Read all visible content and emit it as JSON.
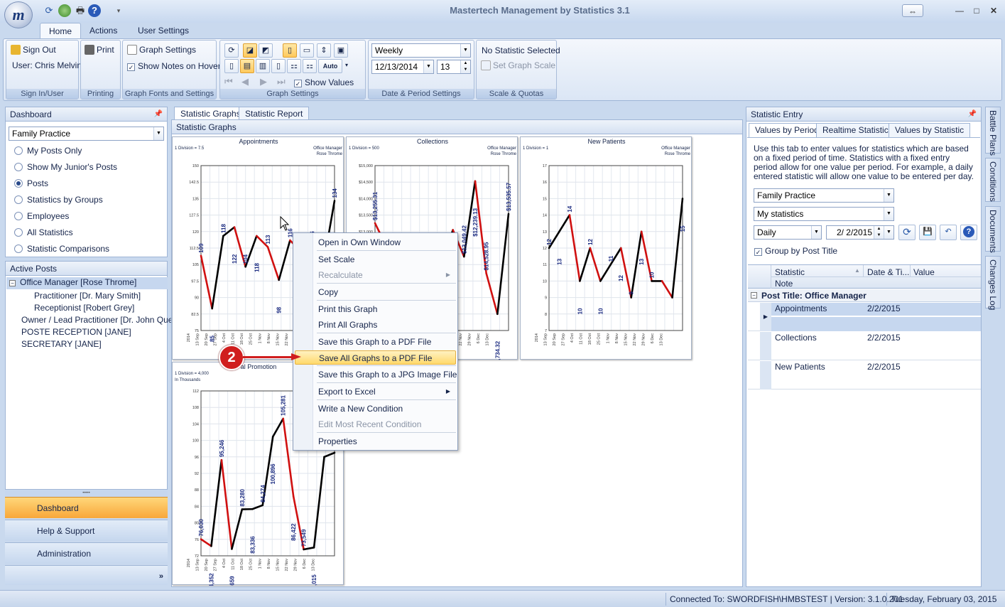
{
  "app": {
    "logo_letter": "m",
    "title": "Mastertech Management by Statistics 3.1"
  },
  "ribbon_tabs": [
    "Home",
    "Actions",
    "User Settings"
  ],
  "ribbon": {
    "sign_out": "Sign Out",
    "user": "User: Chris Melvin",
    "group_signin": "Sign In/User",
    "print": "Print",
    "group_printing": "Printing",
    "graph_settings": "Graph Settings",
    "show_notes": "Show Notes on Hover",
    "group_fonts": "Graph Fonts and Settings",
    "show_values": "Show Values",
    "group_graph": "Graph Settings",
    "auto": "Auto",
    "period": "Weekly",
    "date": "12/13/2014",
    "count": "13",
    "group_date": "Date & Period Settings",
    "no_stat": "No Statistic Selected",
    "set_scale": "Set Graph Scale",
    "group_scale": "Scale & Quotas"
  },
  "dashboard": {
    "title": "Dashboard",
    "combo": "Family Practice",
    "options": [
      "My Posts Only",
      "Show My Junior's Posts",
      "Posts",
      "Statistics by Groups",
      "Employees",
      "All Statistics",
      "Statistic Comparisons"
    ]
  },
  "active_posts": {
    "title": "Active Posts",
    "items": [
      "Office Manager [Rose Throme]",
      "Practitioner  [Dr. Mary Smith]",
      "Receptionist  [Robert Grey]",
      "Owner / Lead Practitioner  [Dr. John Que]",
      "POSTE RECEPTION [JANE]",
      "SECRETARY [JANE]"
    ]
  },
  "nav": [
    "Dashboard",
    "Help & Support",
    "Administration"
  ],
  "content_tabs": [
    "Statistic Graphs",
    "Statistic Report"
  ],
  "content_title": "Statistic Graphs",
  "charts": [
    {
      "title": "Appointments",
      "division": "1 Division = 7.5",
      "sub": "",
      "owner": "Office Manager",
      "owner2": "Rose Throme",
      "ylim": [
        75,
        150
      ],
      "yticks": [
        "150",
        "142.5",
        "135",
        "127.5",
        "120",
        "112.5",
        "105",
        "97.5",
        "90",
        "82.5",
        "75"
      ],
      "values": [
        109,
        85,
        118,
        122,
        104,
        118,
        113,
        98,
        116,
        111,
        116,
        105,
        134
      ],
      "labels": [
        "109",
        "85",
        "118",
        "122",
        "104",
        "118",
        "113",
        "98",
        "116",
        "",
        "16",
        "",
        "134"
      ]
    },
    {
      "title": "Collections",
      "division": "1 Division = 500",
      "sub": "",
      "owner": "Office Manager",
      "owner2": "Rose Throme",
      "ylim": [
        10000,
        15000
      ],
      "yticks": [
        "$15,000",
        "$14,500",
        "$14,000",
        "$13,500",
        "$13,000",
        "$12,500",
        "$12,000",
        "$11,500",
        "$11,000",
        "$10,500",
        "$10,000"
      ],
      "values": [
        13255.31,
        12561.05,
        12600,
        12912.14,
        11782,
        12261,
        12004,
        13049.42,
        12239.13,
        14528.95,
        11734.32,
        10500,
        13535.57
      ],
      "labels": [
        "$13,255.31",
        "$12,561.05",
        "3",
        "$12,912.14",
        "$11,782",
        "",
        "$12,61",
        "04",
        "$13,049.42",
        "$12,239.13",
        "$14,528.95",
        "$11,734.32",
        "$13,535.57"
      ]
    },
    {
      "title": "New Patients",
      "division": "1 Division = 1",
      "sub": "",
      "owner": "Office Manager",
      "owner2": "Rose Throme",
      "ylim": [
        7,
        17
      ],
      "yticks": [
        "17",
        "16",
        "15",
        "14",
        "13",
        "12",
        "11",
        "10",
        "9",
        "8",
        "7"
      ],
      "values": [
        12,
        13,
        14,
        10,
        12,
        10,
        11,
        12,
        9,
        13,
        10,
        10,
        9,
        15
      ],
      "labels": [
        "12",
        "13",
        "14",
        "10",
        "12",
        "10",
        "11",
        "12",
        "9",
        "13",
        "10",
        "",
        "",
        "15"
      ]
    },
    {
      "title": "al Promotion",
      "division": "1 Division = 4,000",
      "sub": "In Thousands",
      "owner": "",
      "owner2": "",
      "ylim": [
        72,
        112
      ],
      "yticks": [
        "112",
        "108",
        "104",
        "100",
        "96",
        "92",
        "88",
        "84",
        "80",
        "76",
        "72"
      ],
      "values": [
        76.03,
        74.352,
        95.246,
        73.659,
        83.28,
        83.336,
        84.274,
        100.896,
        105.281,
        86.422,
        73.549,
        74.015,
        96,
        97
      ],
      "labels": [
        "76,030",
        "74,352",
        "95,246",
        "73,659",
        "83,280",
        "83,336",
        "84,274",
        "100,896",
        "105,281",
        "86,422",
        "73,549",
        "74,015",
        "",
        ""
      ]
    }
  ],
  "chart_data": [
    {
      "type": "line",
      "title": "Appointments",
      "values": [
        109,
        85,
        118,
        122,
        104,
        118,
        113,
        98,
        116,
        111,
        116,
        105,
        134
      ],
      "ylim": [
        75,
        150
      ]
    },
    {
      "type": "line",
      "title": "Collections",
      "values": [
        13255.31,
        12561.05,
        12600,
        12912.14,
        11782,
        12261,
        12004,
        13049.42,
        12239.13,
        14528.95,
        11734.32,
        10500,
        13535.57
      ],
      "ylim": [
        10000,
        15000
      ]
    },
    {
      "type": "line",
      "title": "New Patients",
      "values": [
        12,
        13,
        14,
        10,
        12,
        10,
        11,
        12,
        9,
        13,
        10,
        10,
        9,
        15
      ],
      "ylim": [
        7,
        17
      ]
    },
    {
      "type": "line",
      "title": "al Promotion",
      "values": [
        76.03,
        74.352,
        95.246,
        73.659,
        83.28,
        83.336,
        84.274,
        100.896,
        105.281,
        86.422,
        73.549,
        74.015,
        96,
        97
      ],
      "ylim": [
        72,
        112
      ]
    }
  ],
  "xlabels": [
    "2014",
    "13 Sep",
    "20 Sep",
    "27 Sep",
    "4 Oct",
    "11 Oct",
    "18 Oct",
    "25 Oct",
    "1 Nov",
    "8 Nov",
    "15 Nov",
    "22 Nov",
    "29 Nov",
    "6 Dec",
    "13 Dec"
  ],
  "callout": "2",
  "menu": [
    {
      "label": "Open in Own Window",
      "state": "normal"
    },
    {
      "label": "Set Scale",
      "state": "normal"
    },
    {
      "label": "Recalculate",
      "state": "disabled",
      "sub": true
    },
    {
      "label": "Copy",
      "state": "normal"
    },
    {
      "label": "Print this Graph",
      "state": "normal"
    },
    {
      "label": "Print All Graphs",
      "state": "normal"
    },
    {
      "label": "Save this Graph to a PDF File",
      "state": "normal"
    },
    {
      "label": "Save All Graphs to a PDF File",
      "state": "highlight"
    },
    {
      "label": "Save this Graph to a JPG Image File",
      "state": "normal"
    },
    {
      "label": "Export to Excel",
      "state": "normal",
      "sub": true
    },
    {
      "label": "Write a New Condition",
      "state": "normal"
    },
    {
      "label": "Edit Most Recent Condition",
      "state": "disabled"
    },
    {
      "label": "Properties",
      "state": "normal"
    }
  ],
  "entry": {
    "title": "Statistic Entry",
    "tabs": [
      "Values by Period",
      "Realtime Statistics",
      "Values by Statistic"
    ],
    "desc": "Use this tab to enter values for statistics which are based on a fixed period of time. Statistics with a fixed entry period allow for one value per period. For example, a daily entered statistic will allow one value to be entered per day.",
    "combo1": "Family Practice",
    "combo2": "My statistics",
    "period": "Daily",
    "date": "2/  2/2015",
    "group_by": "Group by Post Title",
    "columns": [
      "Statistic",
      "Date & Ti...",
      "Value"
    ],
    "note_col": "Note",
    "group_header": "Post Title:  Office Manager",
    "rows": [
      {
        "name": "Appointments",
        "date": "2/2/2015"
      },
      {
        "name": "Collections",
        "date": "2/2/2015"
      },
      {
        "name": "New Patients",
        "date": "2/2/2015"
      }
    ]
  },
  "side_tabs": [
    "Battle Plans",
    "Conditions",
    "Documents",
    "Changes Log"
  ],
  "status": {
    "connected": "Connected To: SWORDFISH\\HMBSTEST | Version: 3.1.0.201",
    "date": "Tuesday, February 03, 2015"
  }
}
